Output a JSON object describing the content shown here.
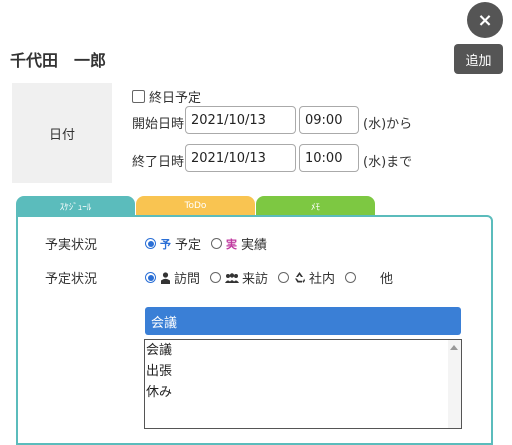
{
  "header": {
    "close_icon": "×",
    "title": "千代田　一郎",
    "add_label": "追加"
  },
  "date_section": {
    "label": "日付",
    "allday_label": "終日予定",
    "start_label": "開始日時",
    "start_date": "2021/10/13",
    "start_time": "09:00",
    "start_suffix": "(水)から",
    "end_label": "終了日時",
    "end_date": "2021/10/13",
    "end_time": "10:00",
    "end_suffix": "(水)まで"
  },
  "tabs": [
    {
      "label": "ｽｹｼﾞｭｰﾙ",
      "color": "#5bbcbc"
    },
    {
      "label": "ToDo",
      "color": "#f9c451"
    },
    {
      "label": "ﾒﾓ",
      "color": "#7dc842"
    }
  ],
  "form": {
    "actual_label": "予実状況",
    "actual_options": [
      {
        "badge": "予",
        "label": "予定",
        "selected": true,
        "badge_color": "#2a6fd6"
      },
      {
        "badge": "実",
        "label": "実績",
        "selected": false,
        "badge_color": "#c03aa0"
      }
    ],
    "plan_label": "予定状況",
    "plan_options": [
      {
        "icon": "person-icon",
        "label": "訪問",
        "selected": true
      },
      {
        "icon": "group-icon",
        "label": "来訪",
        "selected": false
      },
      {
        "icon": "recycle-icon",
        "label": "社内",
        "selected": false
      },
      {
        "icon": "",
        "label": "他",
        "selected": false
      }
    ],
    "category_selected": "会議",
    "category_options": [
      "会議",
      "出張",
      "休み"
    ]
  }
}
